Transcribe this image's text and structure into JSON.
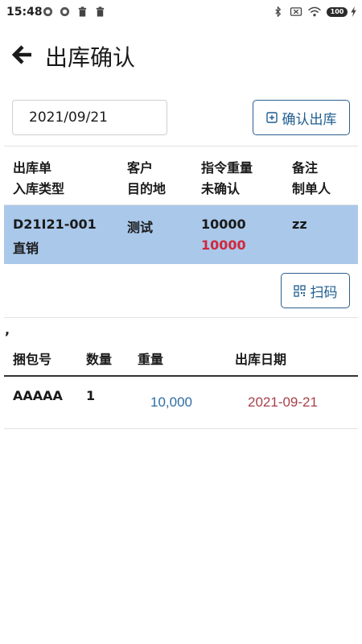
{
  "status_bar": {
    "time": "15:48",
    "battery": "100"
  },
  "header": {
    "title": "出库确认"
  },
  "filter": {
    "date_value": "2021/09/21",
    "confirm_button_label": "确认出库"
  },
  "order_table": {
    "columns": [
      {
        "line1": "出库单",
        "line2": "入库类型"
      },
      {
        "line1": "客户",
        "line2": "目的地"
      },
      {
        "line1": "指令重量",
        "line2": "未确认"
      },
      {
        "line1": "备注",
        "line2": "制单人"
      }
    ],
    "rows": [
      {
        "order_no": "D21I21-001",
        "type": "直销",
        "customer": "测试",
        "destination": "",
        "weight": "10000",
        "unconfirmed": "10000",
        "remark": "zz",
        "creator": ""
      }
    ]
  },
  "scan_button_label": "扫码",
  "separator_text": ",",
  "bundle_table": {
    "columns": [
      "捆包号",
      "数量",
      "重量",
      "出库日期"
    ],
    "rows": [
      {
        "bundle_no": "AAAAA",
        "qty": "1",
        "weight": "10,000",
        "date": "2021-09-21"
      }
    ]
  },
  "colors": {
    "accent": "#1f5d8f",
    "selected_row": "#a9c8ea",
    "alert_red": "#d1283d",
    "weight_blue": "#2e6da4",
    "date_maroon": "#a8404a"
  }
}
